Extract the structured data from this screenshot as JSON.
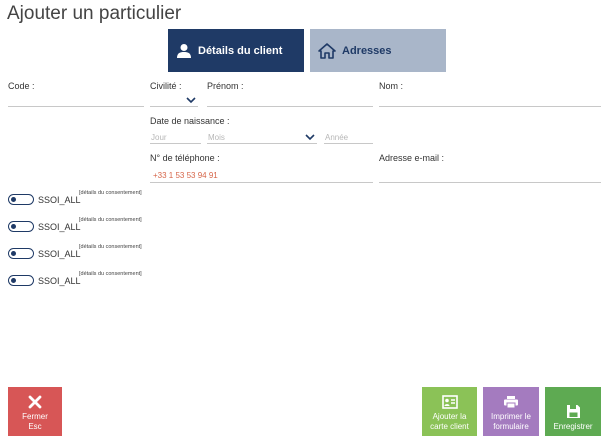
{
  "title": "Ajouter un particulier",
  "tabs": {
    "details": "Détails du client",
    "addresses": "Adresses"
  },
  "form": {
    "code_label": "Code :",
    "civility_label": "Civilité :",
    "firstname_label": "Prénom :",
    "lastname_label": "Nom :",
    "birthdate_label": "Date de naissance :",
    "day_placeholder": "Jour",
    "month_placeholder": "Mois",
    "year_placeholder": "Année",
    "phone_label": "N° de téléphone :",
    "phone_value": "+33 1 53 53 94 91",
    "email_label": "Adresse e-mail :"
  },
  "consents": [
    {
      "label": "SSOI_ALL",
      "details": "[détails du consentement]"
    },
    {
      "label": "SSOI_ALL",
      "details": "[détails du consentement]"
    },
    {
      "label": "SSOI_ALL",
      "details": "[détails du consentement]"
    },
    {
      "label": "SSOI_ALL",
      "details": "[détails du consentement]"
    }
  ],
  "buttons": {
    "close_line1": "Fermer",
    "close_line2": "Esc",
    "card_line1": "Ajouter la",
    "card_line2": "carte client",
    "print_line1": "Imprimer le",
    "print_line2": "formulaire",
    "save": "Enregistrer"
  },
  "colors": {
    "accent": "#1f3a66",
    "close": "#d75656",
    "card": "#8bc257",
    "print": "#a47bbf",
    "save": "#5eaa52",
    "phone": "#d6664a"
  }
}
